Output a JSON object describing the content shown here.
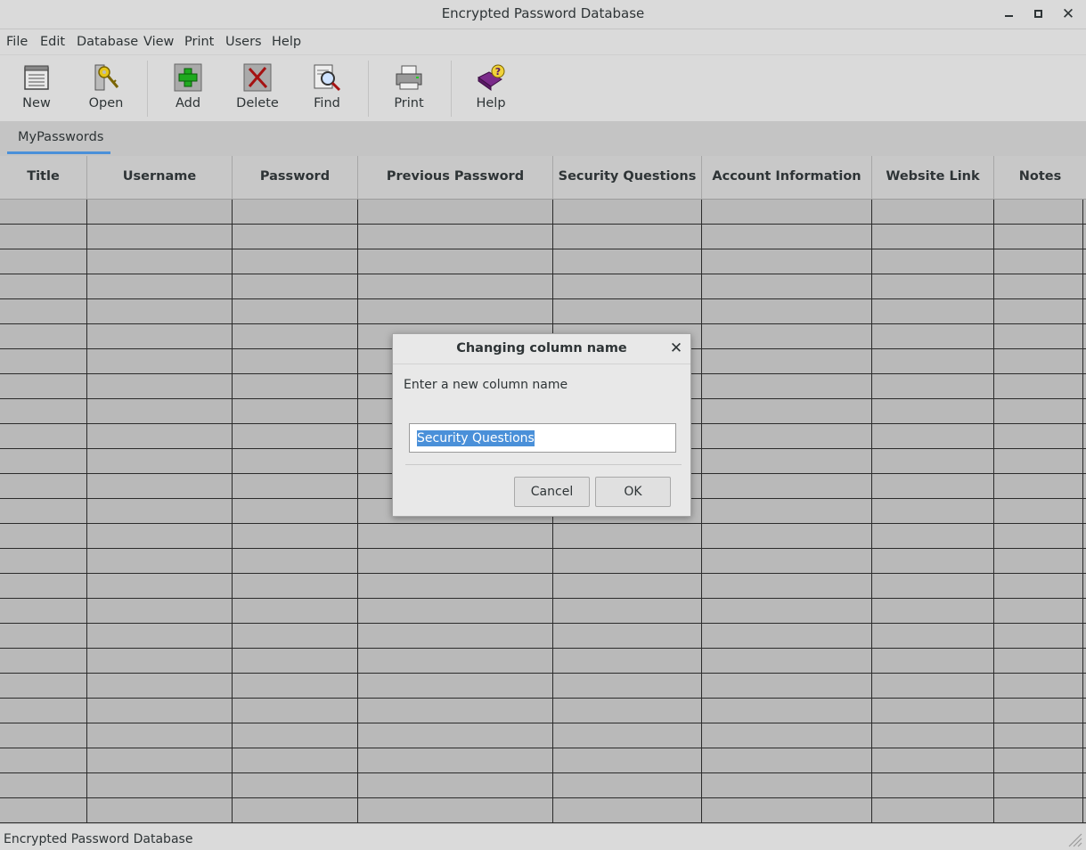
{
  "window": {
    "title": "Encrypted Password Database"
  },
  "menu": [
    "File",
    "Edit",
    "Database",
    "View",
    "Print",
    "Users",
    "Help"
  ],
  "toolbar": {
    "new": "New",
    "open": "Open",
    "add": "Add",
    "delete": "Delete",
    "find": "Find",
    "print": "Print",
    "help": "Help"
  },
  "tab": {
    "label": "MyPasswords"
  },
  "table": {
    "columns": [
      "Title",
      "Username",
      "Password",
      "Previous Password",
      "Security Questions",
      "Account Information",
      "Website Link",
      "Notes"
    ]
  },
  "dialog": {
    "title": "Changing column name",
    "prompt": "Enter a new column name",
    "input_value": "Security Questions",
    "cancel_label": "Cancel",
    "ok_label": "OK"
  },
  "status": {
    "text": "Encrypted Password Database"
  }
}
